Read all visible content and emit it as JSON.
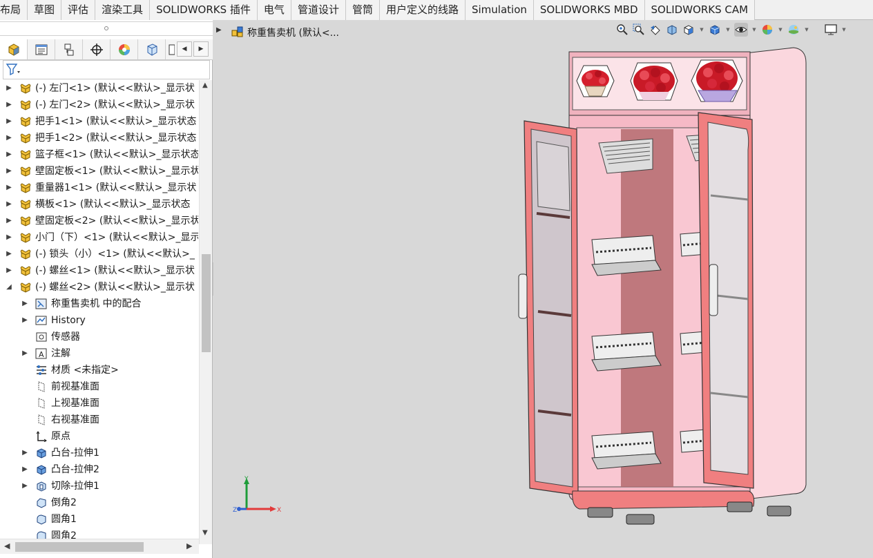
{
  "tabs": [
    "布局",
    "草图",
    "评估",
    "渲染工具",
    "SOLIDWORKS 插件",
    "电气",
    "管道设计",
    "管筒",
    "用户定义的线路",
    "Simulation",
    "SOLIDWORKS MBD",
    "SOLIDWORKS CAM"
  ],
  "panel_tabs": [
    "feature-manager",
    "property-manager",
    "configuration-manager",
    "dimxpert-manager",
    "display-manager",
    "cam-feature-tree",
    "cam-operation-tree"
  ],
  "tree_items": [
    {
      "label": "(-) 左门<1> (默认<<默认>_显示状",
      "kind": "part",
      "expand": true,
      "depth": 0
    },
    {
      "label": "(-) 左门<2> (默认<<默认>_显示状",
      "kind": "part",
      "expand": true,
      "depth": 0
    },
    {
      "label": "把手1<1> (默认<<默认>_显示状态",
      "kind": "part",
      "expand": true,
      "depth": 0
    },
    {
      "label": "把手1<2> (默认<<默认>_显示状态",
      "kind": "part",
      "expand": true,
      "depth": 0
    },
    {
      "label": "篮子框<1> (默认<<默认>_显示状态",
      "kind": "part",
      "expand": true,
      "depth": 0
    },
    {
      "label": "壁固定板<1> (默认<<默认>_显示状",
      "kind": "part",
      "expand": true,
      "depth": 0
    },
    {
      "label": "重量器1<1> (默认<<默认>_显示状",
      "kind": "part",
      "expand": true,
      "depth": 0
    },
    {
      "label": "横板<1> (默认<<默认>_显示状态 ",
      "kind": "part",
      "expand": true,
      "depth": 0
    },
    {
      "label": "壁固定板<2> (默认<<默认>_显示状",
      "kind": "part",
      "expand": true,
      "depth": 0
    },
    {
      "label": "小门（下）<1> (默认<<默认>_显示",
      "kind": "part",
      "expand": true,
      "depth": 0
    },
    {
      "label": "(-) 锁头（小）<1> (默认<<默认>_",
      "kind": "part",
      "expand": true,
      "depth": 0
    },
    {
      "label": "(-) 螺丝<1> (默认<<默认>_显示状",
      "kind": "part",
      "expand": true,
      "depth": 0
    },
    {
      "label": "(-) 螺丝<2> (默认<<默认>_显示状",
      "kind": "part",
      "expand": true,
      "depth": 0,
      "open": true
    },
    {
      "label": "称重售卖机 中的配合",
      "kind": "mates",
      "expand": true,
      "depth": 1
    },
    {
      "label": "History",
      "kind": "history",
      "expand": true,
      "depth": 1
    },
    {
      "label": "传感器",
      "kind": "sensor",
      "expand": false,
      "depth": 1
    },
    {
      "label": "注解",
      "kind": "annotation",
      "expand": true,
      "depth": 1
    },
    {
      "label": "材质 <未指定>",
      "kind": "material",
      "expand": false,
      "depth": 1
    },
    {
      "label": "前视基准面",
      "kind": "plane",
      "expand": false,
      "depth": 1
    },
    {
      "label": "上视基准面",
      "kind": "plane",
      "expand": false,
      "depth": 1
    },
    {
      "label": "右视基准面",
      "kind": "plane",
      "expand": false,
      "depth": 1
    },
    {
      "label": "原点",
      "kind": "origin",
      "expand": false,
      "depth": 1
    },
    {
      "label": "凸台-拉伸1",
      "kind": "extrude",
      "expand": true,
      "depth": 1
    },
    {
      "label": "凸台-拉伸2",
      "kind": "extrude",
      "expand": true,
      "depth": 1
    },
    {
      "label": "切除-拉伸1",
      "kind": "cut",
      "expand": true,
      "depth": 1
    },
    {
      "label": "倒角2",
      "kind": "chamfer",
      "expand": false,
      "depth": 1
    },
    {
      "label": "圆角1",
      "kind": "fillet",
      "expand": false,
      "depth": 1
    },
    {
      "label": "圆角2",
      "kind": "fillet",
      "expand": false,
      "depth": 1
    }
  ],
  "viewport": {
    "title": "称重售卖机  (默认<...",
    "heads_up_icons": [
      "zoom-to-fit-icon",
      "zoom-to-area-icon",
      "previous-view-icon",
      "section-view-icon",
      "view-orientation-icon",
      "display-style-icon",
      "hide-show-items-icon",
      "edit-appearance-icon",
      "apply-scene-icon",
      "view-settings-icon"
    ],
    "axes": {
      "x": "X",
      "y": "Y",
      "z": "Z"
    }
  },
  "colors": {
    "cabinet_pink": "#f6b9c6",
    "door_red": "#f07f80",
    "axis_x": "#e23a3a",
    "axis_y": "#1f9d3a",
    "axis_z": "#2f5fd0",
    "part_icon": "#e6a817"
  }
}
